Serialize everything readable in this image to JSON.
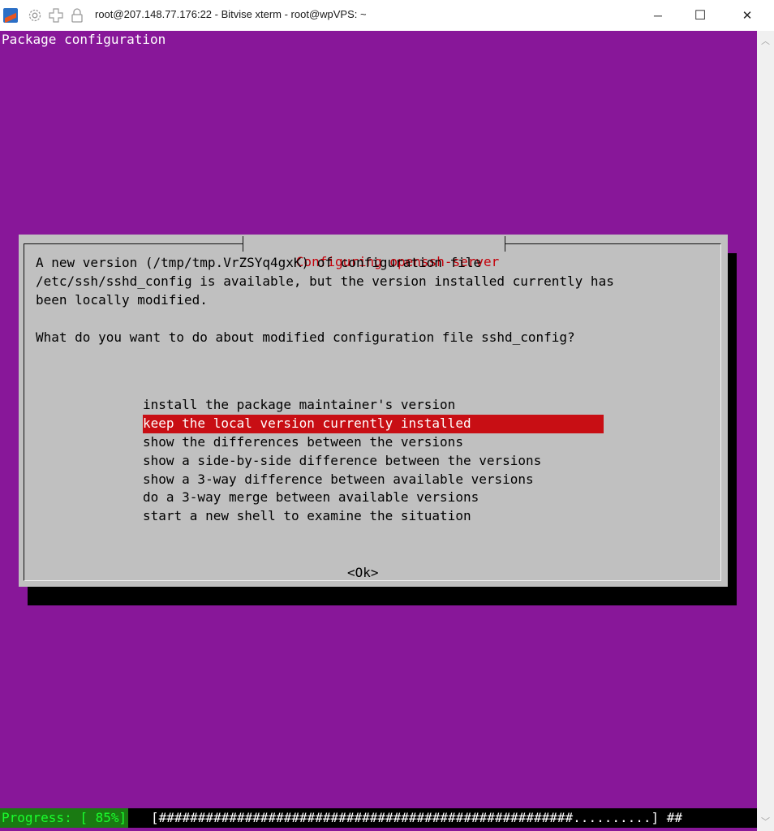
{
  "window": {
    "title": "root@207.148.77.176:22 - Bitvise xterm - root@wpVPS: ~",
    "minimize_glyph": "─",
    "maximize_glyph": "☐",
    "close_glyph": "✕"
  },
  "terminal": {
    "header": "Package configuration",
    "background": "#881799"
  },
  "dialog": {
    "title": "Configuring openssh-server",
    "lines": [
      "A new version (/tmp/tmp.VrZSYq4gxK) of configuration file",
      "/etc/ssh/sshd_config is available, but the version installed currently has",
      "been locally modified."
    ],
    "question": "What do you want to do about modified configuration file sshd_config?",
    "options": [
      "install the package maintainer's version",
      "keep the local version currently installed",
      "show the differences between the versions",
      "show a side-by-side difference between the versions",
      "show a 3-way difference between available versions",
      "do a 3-way merge between available versions",
      "start a new shell to examine the situation"
    ],
    "selected_index": 1,
    "selected_color": "#c80e14",
    "ok_button": "<Ok>"
  },
  "progress": {
    "label": "Progress: [ 85%]",
    "percent": 85,
    "bar": "[#####################################################..........] ##"
  },
  "icons": [
    "app-icon",
    "settings-icon",
    "new-window-icon",
    "lock-icon"
  ]
}
